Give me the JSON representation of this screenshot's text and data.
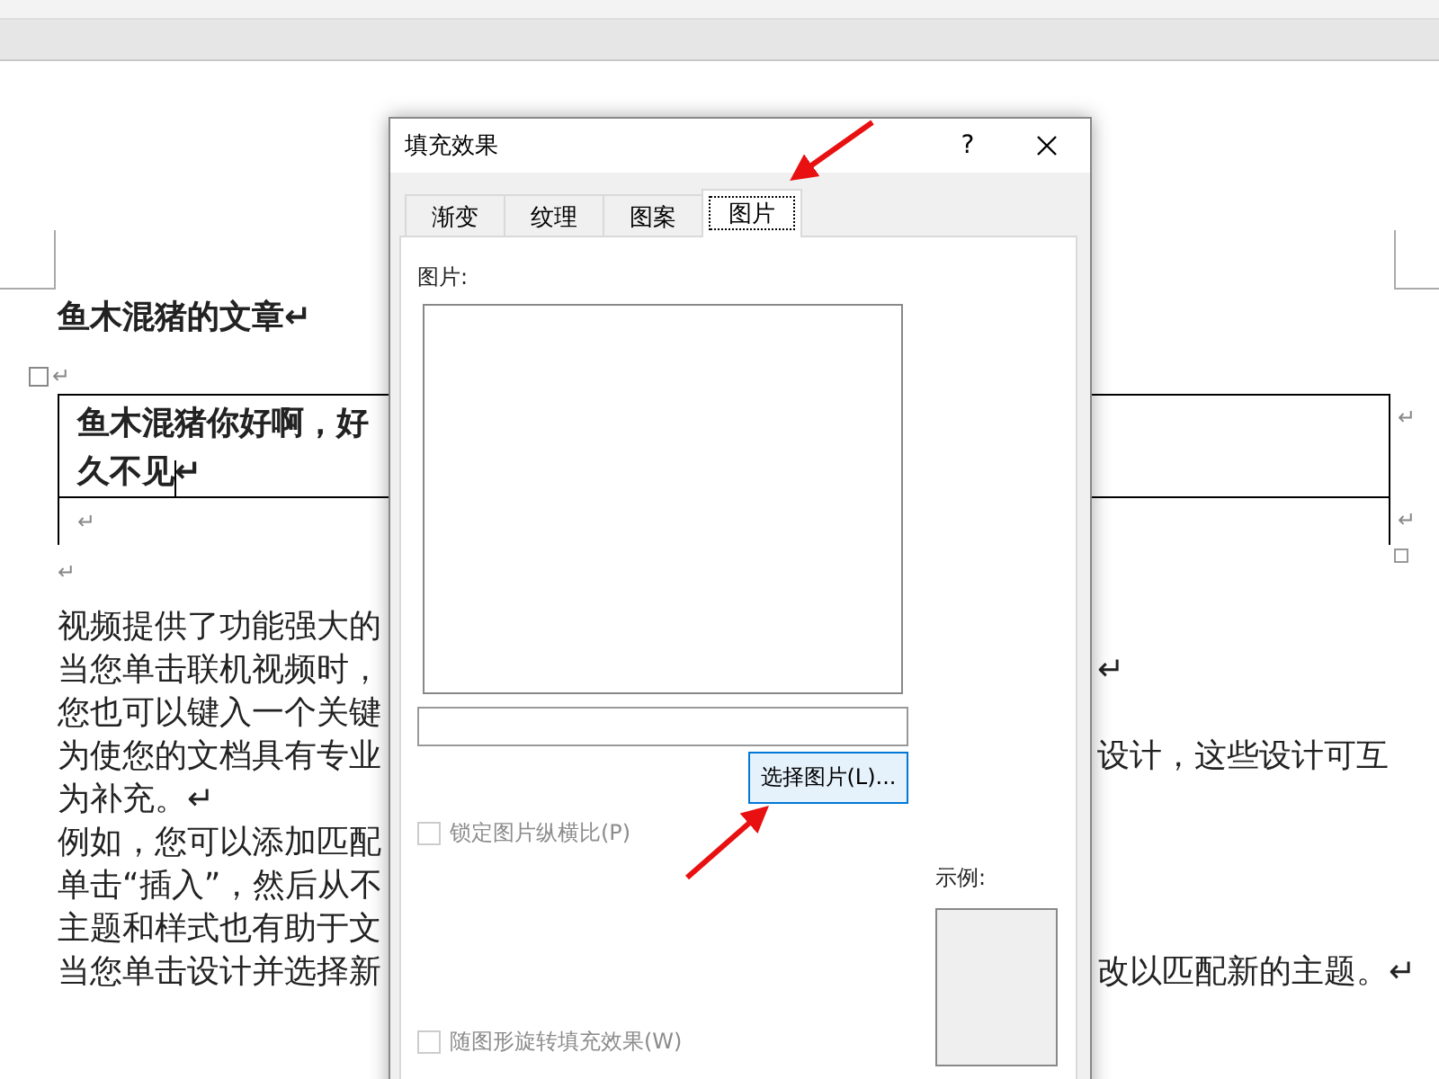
{
  "document": {
    "heading": "鱼木混猪的文章↵",
    "table_anchor_mark": "↵",
    "table": {
      "rows": [
        {
          "cells": [
            "鱼木混猪你好啊，好久不见↵"
          ],
          "end_mark": "↵",
          "cursor": true
        },
        {
          "cells": [
            "↵"
          ],
          "end_mark": "↵",
          "cursor": false
        }
      ]
    },
    "after_table_mark": "↵",
    "lines": [
      {
        "text": "视频提供了功能强大的"
      },
      {
        "text": "当您单击联机视频时，",
        "right": "↵"
      },
      {
        "text": "您也可以键入一个关键"
      },
      {
        "text": "为使您的文档具有专业",
        "right": "设计，这些设计可互"
      },
      {
        "text": "为补充。↵"
      },
      {
        "text": "例如，您可以添加匹配"
      },
      {
        "text": "单击“插入”，然后从不"
      },
      {
        "text": "主题和样式也有助于文"
      },
      {
        "text": "当您单击设计并选择新",
        "right": "改以匹配新的主题。↵"
      }
    ]
  },
  "dialog": {
    "title": "填充效果",
    "help": "?",
    "tabs": [
      {
        "label": "渐变",
        "selected": false
      },
      {
        "label": "纹理",
        "selected": false
      },
      {
        "label": "图案",
        "selected": false
      },
      {
        "label": "图片",
        "selected": true
      }
    ],
    "picture_label": "图片:",
    "choose_button": "选择图片(L)...",
    "lock_checkbox": {
      "label": "锁定图片纵横比(P)",
      "checked": false,
      "disabled": true
    },
    "preview_label": "示例:",
    "rotate_checkbox": {
      "label": "随图形旋转填充效果(W)",
      "checked": false,
      "disabled": true
    }
  }
}
